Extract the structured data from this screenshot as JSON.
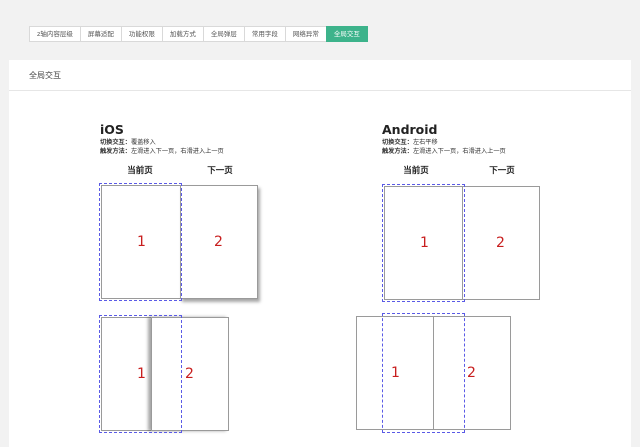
{
  "tabs": [
    {
      "label": "z轴内容层级",
      "active": false
    },
    {
      "label": "屏幕适配",
      "active": false
    },
    {
      "label": "功能权限",
      "active": false
    },
    {
      "label": "加载方式",
      "active": false
    },
    {
      "label": "全局弹层",
      "active": false
    },
    {
      "label": "常用字段",
      "active": false
    },
    {
      "label": "网络异常",
      "active": false
    },
    {
      "label": "全局交互",
      "active": true
    }
  ],
  "panel": {
    "title": "全局交互"
  },
  "ios": {
    "title": "iOS",
    "interaction_label": "切换交互：",
    "interaction_value": "覆盖移入",
    "trigger_label": "触发方法：",
    "trigger_value": "左滑进入下一页，右滑进入上一页",
    "current_label": "当前页",
    "next_label": "下一页",
    "page1": "1",
    "page2": "2"
  },
  "android": {
    "title": "Android",
    "interaction_label": "切换交互：",
    "interaction_value": "左右平移",
    "trigger_label": "触发方法：",
    "trigger_value": "左滑进入下一页，右滑进入上一页",
    "current_label": "当前页",
    "next_label": "下一页",
    "page1": "1",
    "page2": "2"
  },
  "colors": {
    "accent": "#3db38b",
    "page_number": "#c81e1e",
    "viewport_dash": "#5a5ae6"
  }
}
